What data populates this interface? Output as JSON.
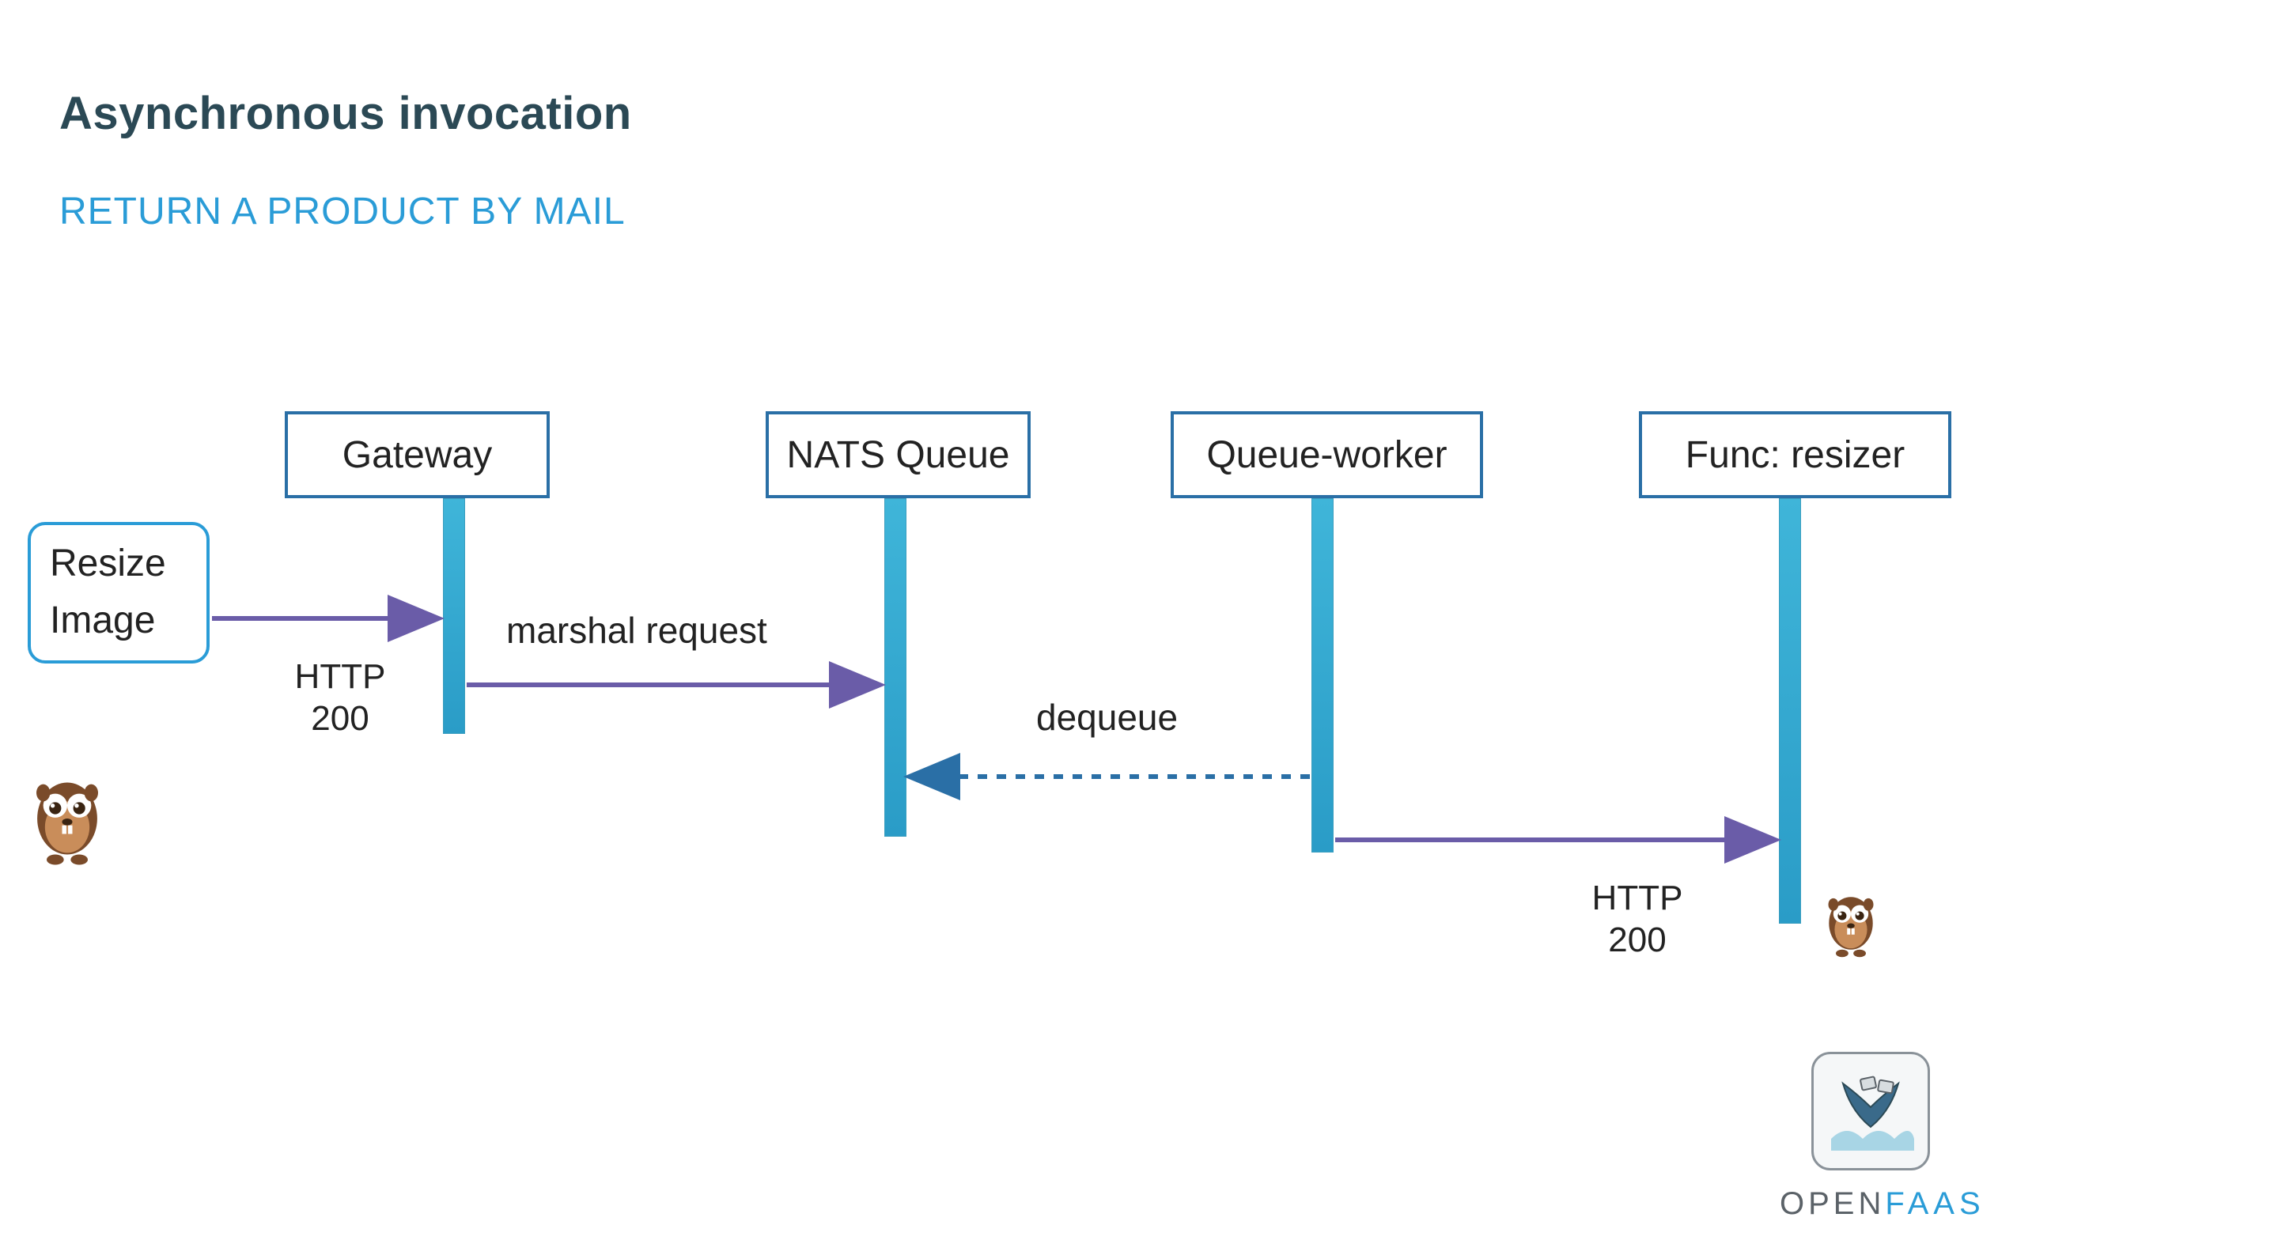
{
  "title": "Asynchronous invocation",
  "subtitle": "RETURN A PRODUCT BY MAIL",
  "actor": {
    "line1": "Resize",
    "line2": "Image"
  },
  "lifelines": {
    "gateway": "Gateway",
    "nats": "NATS Queue",
    "worker": "Queue-worker",
    "func": "Func: resizer"
  },
  "messages": {
    "marshal": "marshal request",
    "dequeue": "dequeue"
  },
  "responses": {
    "http200a": "HTTP\n200",
    "http200b": "HTTP\n200"
  },
  "logo": {
    "open": "OPEN",
    "faas": "FAAS"
  }
}
